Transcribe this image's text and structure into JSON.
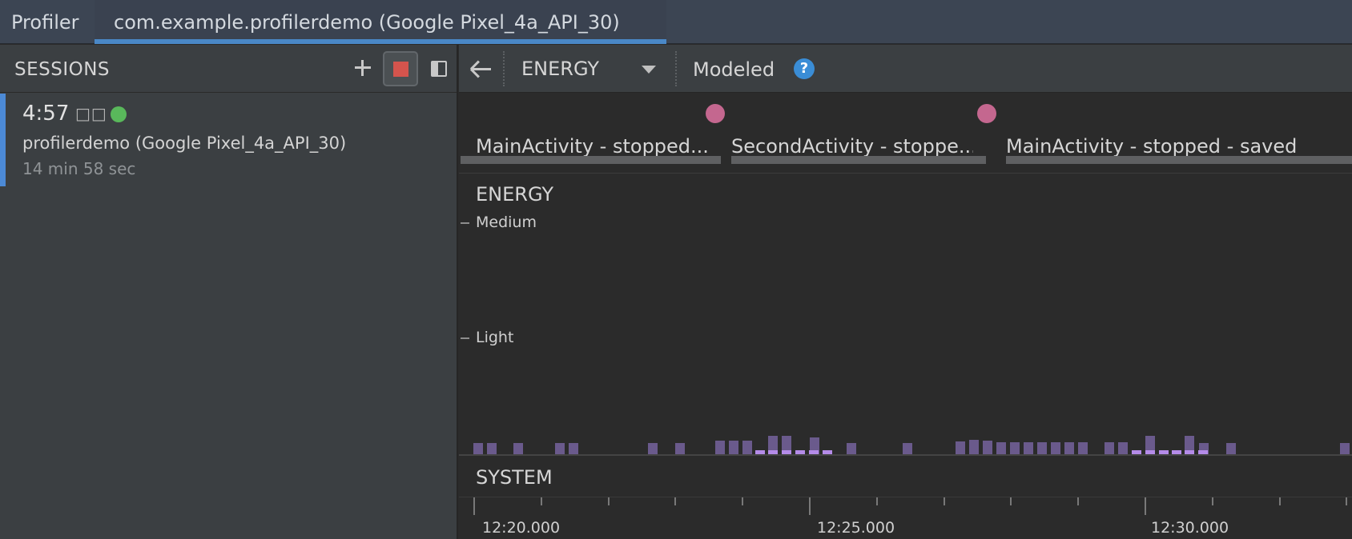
{
  "tabs": {
    "profiler": "Profiler",
    "session": "com.example.profilerdemo (Google Pixel_4a_API_30)"
  },
  "sidebar": {
    "title": "SESSIONS",
    "session": {
      "time": "4:57",
      "boxes": "□□",
      "name": "profilerdemo (Google Pixel_4a_API_30)",
      "duration": "14 min 58 sec",
      "status_color": "#59b85b"
    }
  },
  "toolbar": {
    "dropdown_value": "ENERGY",
    "modeled_label": "Modeled",
    "help_icon_glyph": "?"
  },
  "activities": [
    {
      "label": "MainActivity - stopped..."
    },
    {
      "label": "SecondActivity - stoppe..."
    },
    {
      "label": "MainActivity - stopped - saved"
    }
  ],
  "energy": {
    "section_title": "ENERGY",
    "levels": {
      "medium": "Medium",
      "light": "Light"
    },
    "bar_color": "#6a5a8c",
    "highlight_color": "#b48be8"
  },
  "system": {
    "section_title": "SYSTEM"
  },
  "timeline": {
    "labels": [
      "12:20.000",
      "12:25.000",
      "12:30.000"
    ]
  },
  "colors": {
    "accent": "#4a88c7",
    "record_stop": "#d4544d",
    "event_marker": "#c4678f",
    "help_icon": "#3a8dd6"
  }
}
